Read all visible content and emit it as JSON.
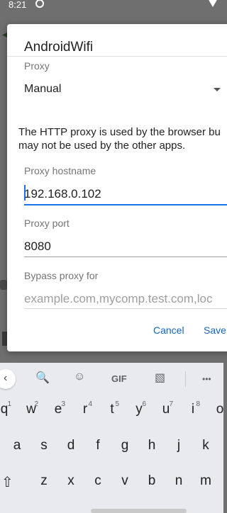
{
  "status_bar": {
    "time": "8:21"
  },
  "dialog": {
    "title": "AndroidWifi",
    "proxy_label": "Proxy",
    "proxy_value": "Manual",
    "info_line1": "The HTTP proxy is used by the browser bu",
    "info_line2": "may not be used by the other apps.",
    "hostname_label": "Proxy hostname",
    "hostname_value": "192.168.0.102",
    "port_label": "Proxy port",
    "port_value": "8080",
    "bypass_label": "Bypass proxy for",
    "bypass_placeholder": "example.com,mycomp.test.com,loc",
    "cancel": "Cancel",
    "save": "Save"
  },
  "keyboard": {
    "toolbar": {
      "gif": "GIF",
      "more": "•••"
    },
    "row1": [
      {
        "k": "q",
        "h": "1"
      },
      {
        "k": "w",
        "h": "2"
      },
      {
        "k": "e",
        "h": "3"
      },
      {
        "k": "r",
        "h": "4"
      },
      {
        "k": "t",
        "h": "5"
      },
      {
        "k": "y",
        "h": "6"
      },
      {
        "k": "u",
        "h": "7"
      },
      {
        "k": "i",
        "h": "8"
      },
      {
        "k": "o",
        "h": ""
      }
    ],
    "row2": [
      "a",
      "s",
      "d",
      "f",
      "g",
      "h",
      "j",
      "k"
    ],
    "row3": [
      "z",
      "x",
      "c",
      "v",
      "b",
      "n",
      "m"
    ],
    "accent_color": "#1a73e8"
  }
}
